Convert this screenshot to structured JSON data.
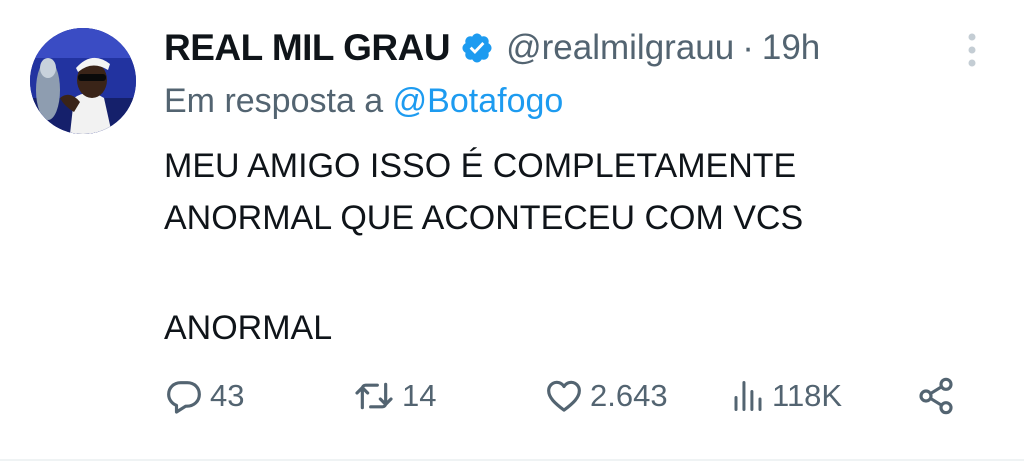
{
  "tweet": {
    "display_name": "REAL MIL GRAU",
    "handle": "@realmilgrauu",
    "separator": "·",
    "time": "19h",
    "reply_prefix": "Em resposta a",
    "reply_to": "@Botafogo",
    "text_lines": [
      "MEU AMIGO ISSO É COMPLETAMENTE",
      "ANORMAL QUE ACONTECEU COM VCS",
      "",
      "ANORMAL"
    ]
  },
  "actions": {
    "reply_count": "43",
    "retweet_count": "14",
    "like_count": "2.643",
    "views_count": "118K"
  },
  "icons": {
    "verified": "verified-badge-icon",
    "more": "more-vertical-icon",
    "reply": "reply-icon",
    "retweet": "retweet-icon",
    "like": "heart-icon",
    "views": "views-chart-icon",
    "share": "share-icon"
  },
  "colors": {
    "text": "#0f1419",
    "secondary": "#536471",
    "link": "#1d9bf0",
    "verified": "#1d9bf0"
  }
}
